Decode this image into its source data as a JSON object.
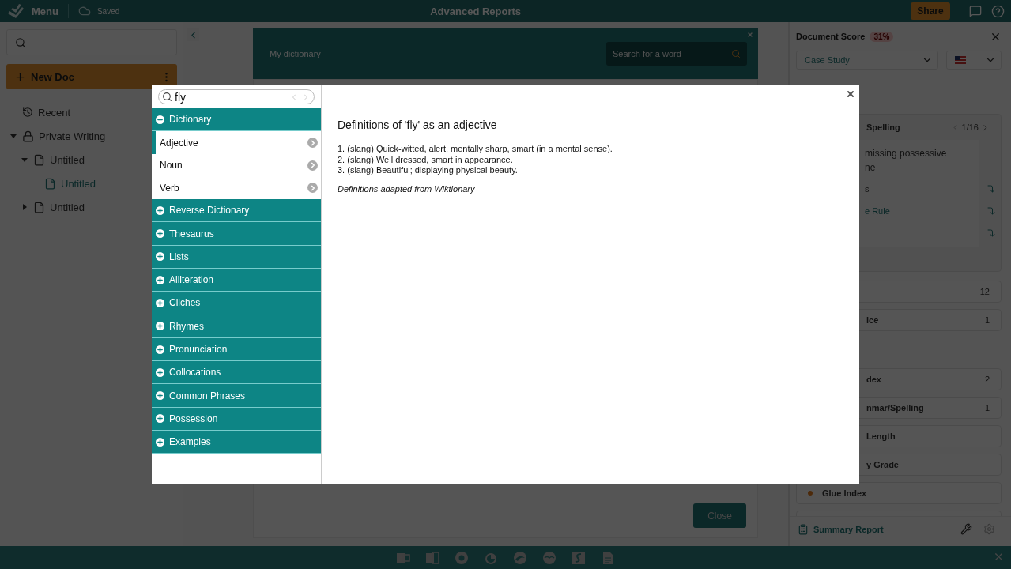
{
  "top_bar": {
    "menu_label": "Menu",
    "save_status": "Saved",
    "title": "Advanced Reports",
    "share_button": "Share"
  },
  "sidebar": {
    "new_doc_button": "New Doc",
    "tree": [
      {
        "label": "Recent",
        "kind": "history"
      },
      {
        "label": "Private Writing",
        "kind": "folder",
        "expanded": true,
        "children": [
          {
            "label": "Untitled",
            "kind": "document",
            "expanded": true,
            "selected": false,
            "children": [
              {
                "label": "Untitled",
                "kind": "document",
                "selected": true
              }
            ]
          },
          {
            "label": "Untitled",
            "kind": "document",
            "expanded": false,
            "selected": false
          }
        ]
      }
    ]
  },
  "background_dialog": {
    "title": "My dictionary",
    "search_placeholder": "Search for a word",
    "close_button": "Close"
  },
  "score_panel": {
    "title": "Document Score",
    "score": "31%",
    "report_type": "Case Study",
    "issue": {
      "title": "Spelling",
      "pager": "1/16",
      "message_lines": [
        "missing possessive",
        "ne"
      ],
      "options": [
        {
          "kind": "plain",
          "text": "s"
        },
        {
          "kind": "link",
          "text": "e Rule"
        },
        {
          "kind": "empty"
        }
      ]
    },
    "metric_groups": [
      [
        {
          "count": "12",
          "marked": false
        },
        {
          "label": "ice",
          "count": "1",
          "marked": false
        }
      ],
      [
        {
          "label": "dex",
          "count": "2",
          "marked": false
        },
        {
          "label": "nmar/Spelling",
          "count": "1",
          "marked": false
        },
        {
          "label": "Length",
          "marked": false
        },
        {
          "label": "y Grade",
          "marked": false
        },
        {
          "label": "Glue Index",
          "marked": true
        },
        {
          "marked": false
        }
      ]
    ],
    "summary_link": "Summary Report"
  },
  "dictionary_modal": {
    "search": {
      "value": "fly"
    },
    "sections": [
      {
        "label": "Dictionary",
        "expanded": true,
        "items": [
          {
            "label": "Adjective",
            "selected": true
          },
          {
            "label": "Noun",
            "selected": false
          },
          {
            "label": "Verb",
            "selected": false
          }
        ]
      },
      {
        "label": "Reverse Dictionary",
        "expanded": false
      },
      {
        "label": "Thesaurus",
        "expanded": false
      },
      {
        "label": "Lists",
        "expanded": false
      },
      {
        "label": "Alliteration",
        "expanded": false
      },
      {
        "label": "Cliches",
        "expanded": false
      },
      {
        "label": "Rhymes",
        "expanded": false
      },
      {
        "label": "Pronunciation",
        "expanded": false
      },
      {
        "label": "Collocations",
        "expanded": false
      },
      {
        "label": "Common Phrases",
        "expanded": false
      },
      {
        "label": "Possession",
        "expanded": false
      },
      {
        "label": "Examples",
        "expanded": false
      }
    ],
    "heading": "Definitions of 'fly' as an adjective",
    "definitions": [
      "1. (slang) Quick-witted, alert, mentally sharp, smart (in a mental sense).",
      "2. (slang) Well dressed, smart in appearance.",
      "3. (slang) Beautiful; displaying physical beauty."
    ],
    "credit": "Definitions adapted from Wiktionary"
  }
}
